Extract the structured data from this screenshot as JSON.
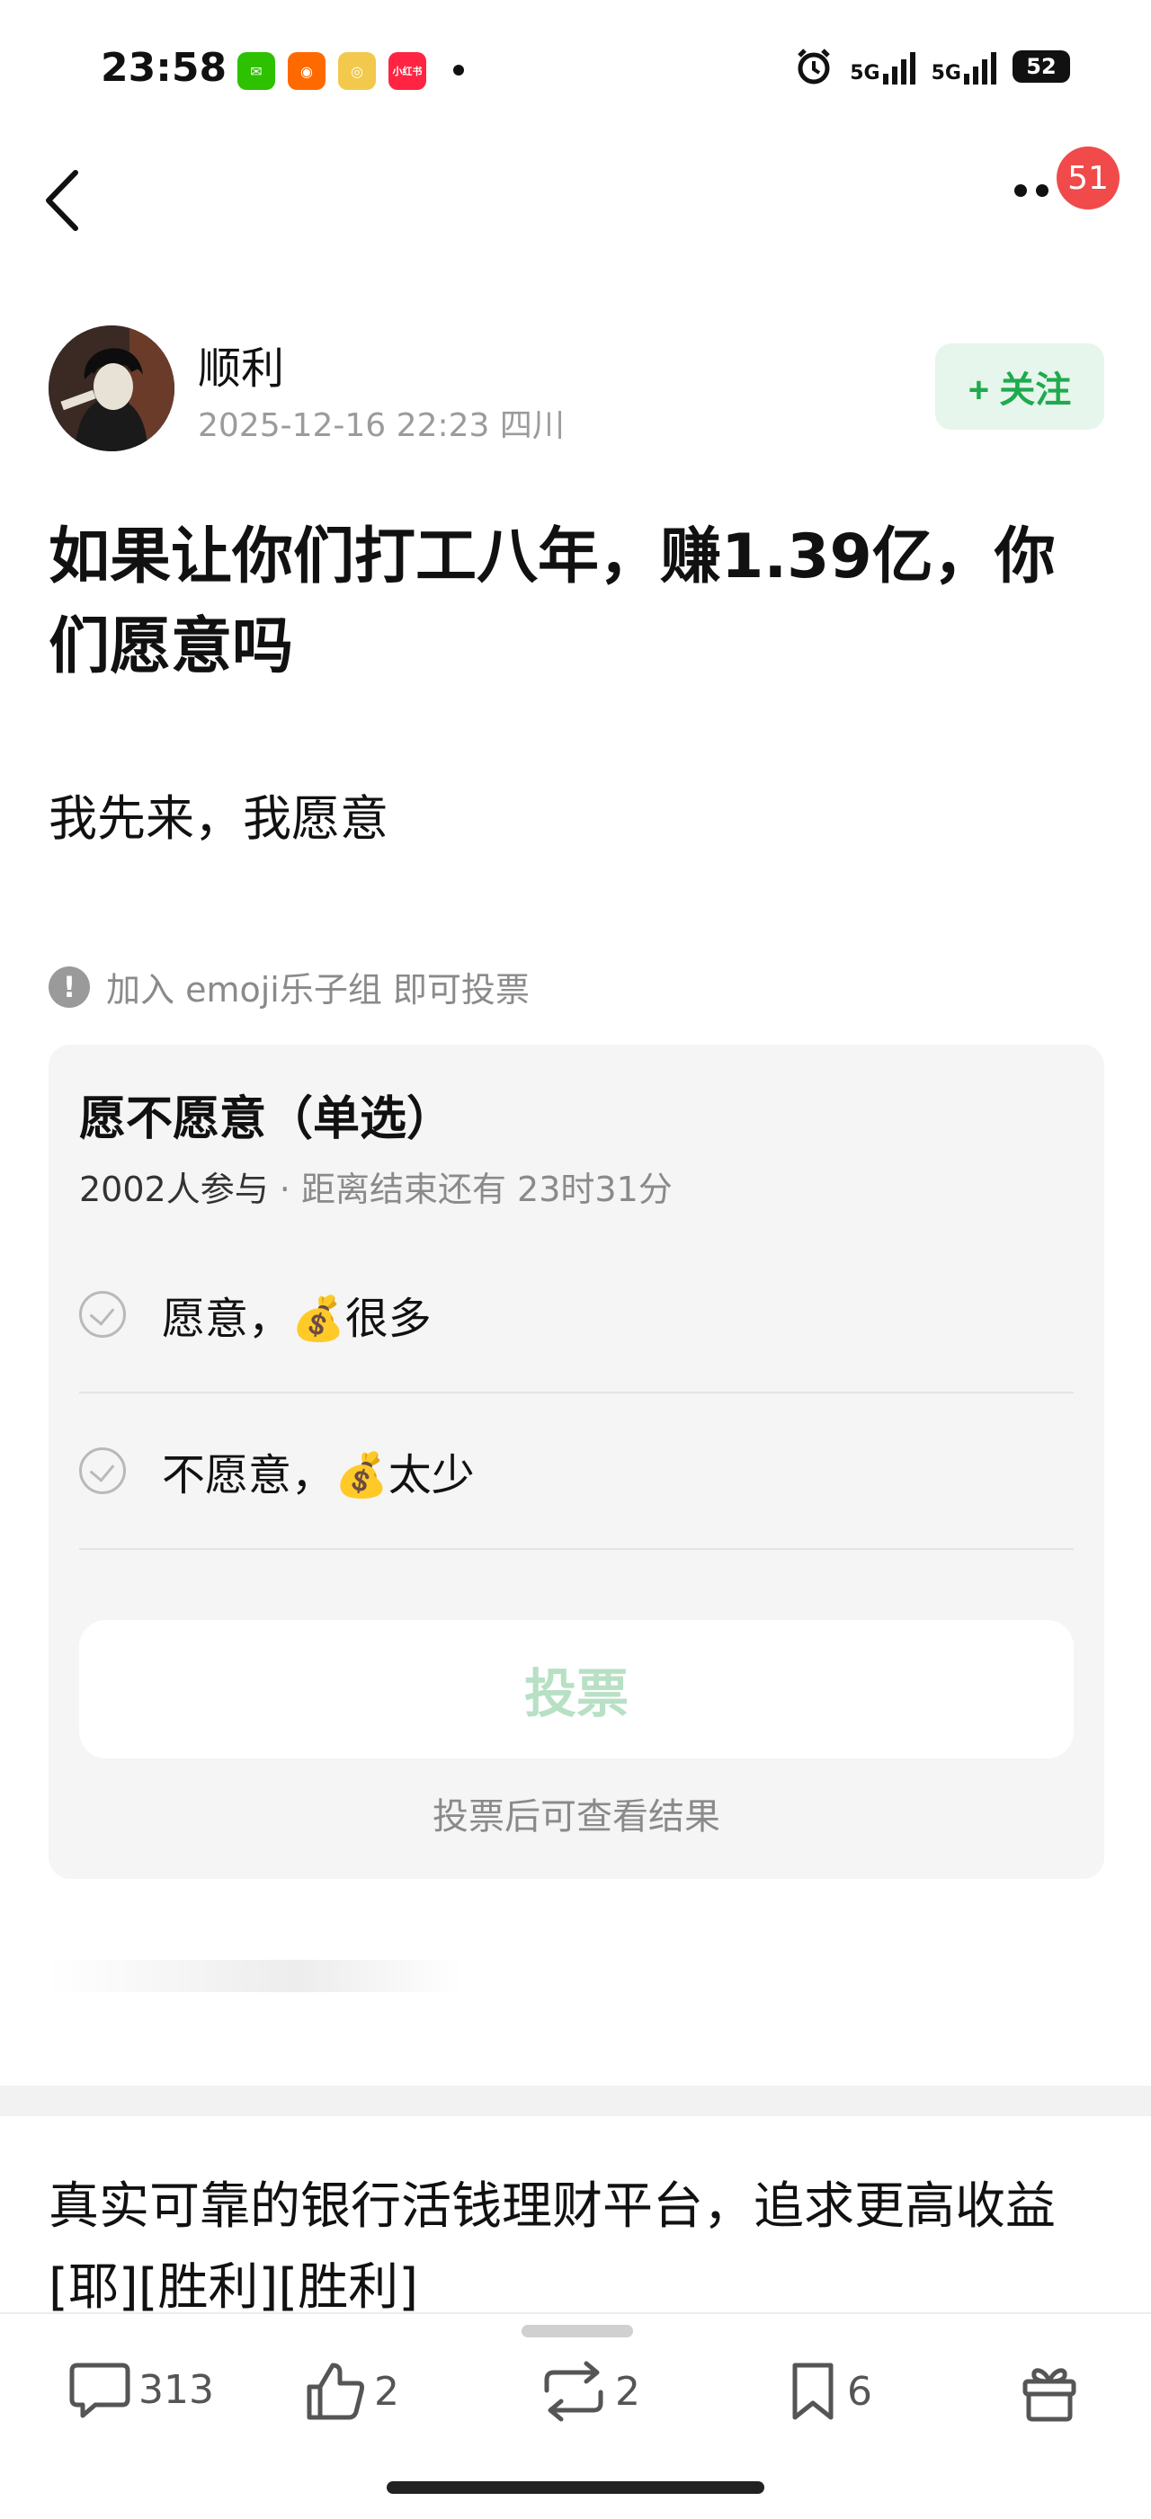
{
  "status_bar": {
    "time": "23:58",
    "signal1": "5G",
    "signal2": "5G",
    "battery": "52",
    "apps": [
      {
        "name": "wechat-icon",
        "color": "#2dc100",
        "glyph": "✉"
      },
      {
        "name": "kuaishou-icon",
        "color": "#ff6a00",
        "glyph": "◉"
      },
      {
        "name": "weibo-icon",
        "color": "#f2c94c",
        "glyph": "◎"
      },
      {
        "name": "xiaohongshu-icon",
        "color": "#ff2442",
        "glyph": "小红书"
      }
    ]
  },
  "nav": {
    "badge_count": "51"
  },
  "post": {
    "author": "顺利",
    "meta": "2025-12-16 22:23  四川",
    "follow_label": "+ 关注",
    "title": "如果让你们打工八年，赚1.39亿，你们愿意吗",
    "body": "我先来，我愿意"
  },
  "notice": {
    "icon": "!",
    "text": "加入 emoji乐子组 即可投票"
  },
  "poll": {
    "title": "愿不愿意（单选）",
    "participants": "2002人参与",
    "separator": " · ",
    "remaining": "距离结束还有 23时31分",
    "options": [
      {
        "label": "愿意，💰很多"
      },
      {
        "label": "不愿意，💰太少"
      }
    ],
    "vote_label": "投票",
    "hint": "投票后可查看结果"
  },
  "ad": {
    "text": "真实可靠的银行活钱理财平台，追求更高收益[耶][胜利][胜利]"
  },
  "actions": {
    "comments": "313",
    "likes": "2",
    "reposts": "2",
    "favorites": "6"
  }
}
